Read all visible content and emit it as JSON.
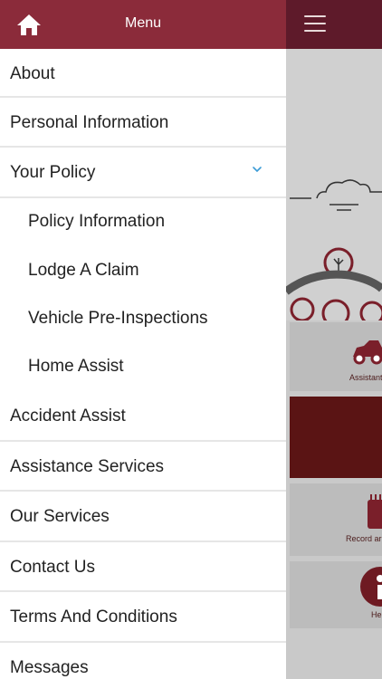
{
  "header": {
    "title": "Menu"
  },
  "menu": {
    "items": [
      {
        "label": "About"
      },
      {
        "label": "Personal Information"
      },
      {
        "label": "Your Policy"
      },
      {
        "label": "Accident Assist"
      },
      {
        "label": "Assistance Services"
      },
      {
        "label": "Our Services"
      },
      {
        "label": "Contact Us"
      },
      {
        "label": "Terms And Conditions"
      },
      {
        "label": "Messages"
      }
    ],
    "policy_subitems": [
      {
        "label": "Policy Information"
      },
      {
        "label": "Lodge A Claim"
      },
      {
        "label": "Vehicle Pre-Inspections"
      },
      {
        "label": "Home Assist"
      }
    ]
  },
  "background": {
    "tiles": [
      {
        "label": "Assistant"
      },
      {
        "label": "Record ar"
      },
      {
        "label": "He"
      }
    ]
  },
  "colors": {
    "drawer_header": "#8b2b3a",
    "topbar": "#5e1a2a",
    "chevron_accent": "#3a9bd6"
  },
  "icons": {
    "home": "home-icon",
    "menu": "hamburger-icon",
    "expand": "chevron-down-icon"
  }
}
